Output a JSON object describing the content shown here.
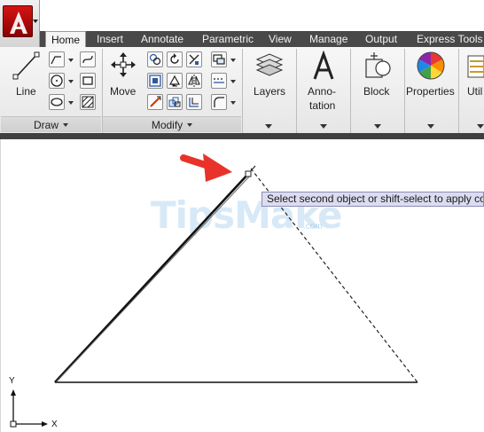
{
  "app": {
    "menu_icon": "autocad-logo-icon"
  },
  "tabs": [
    {
      "label": "Home",
      "active": true
    },
    {
      "label": "Insert",
      "active": false
    },
    {
      "label": "Annotate",
      "active": false
    },
    {
      "label": "Parametric",
      "active": false
    },
    {
      "label": "View",
      "active": false
    },
    {
      "label": "Manage",
      "active": false
    },
    {
      "label": "Output",
      "active": false
    },
    {
      "label": "Express Tools",
      "active": false
    }
  ],
  "ribbon": {
    "draw": {
      "line_label": "Line",
      "panel_label": "Draw"
    },
    "modify": {
      "move_label": "Move",
      "panel_label": "Modify"
    },
    "layers_label": "Layers",
    "annotation_label_line1": "Anno-",
    "annotation_label_line2": "tation",
    "block_label": "Block",
    "properties_label": "Properties",
    "utilities_label": "Util"
  },
  "canvas": {
    "tooltip": "Select second object or shift-select to apply co",
    "watermark": "TipsMake",
    "watermark_sub": ".com",
    "ucs": {
      "y_label": "Y",
      "x_label": "X"
    }
  },
  "colors": {
    "accent": "#e8332a",
    "tab_bar": "#494949",
    "tooltip_bg": "#dcdcf0"
  }
}
